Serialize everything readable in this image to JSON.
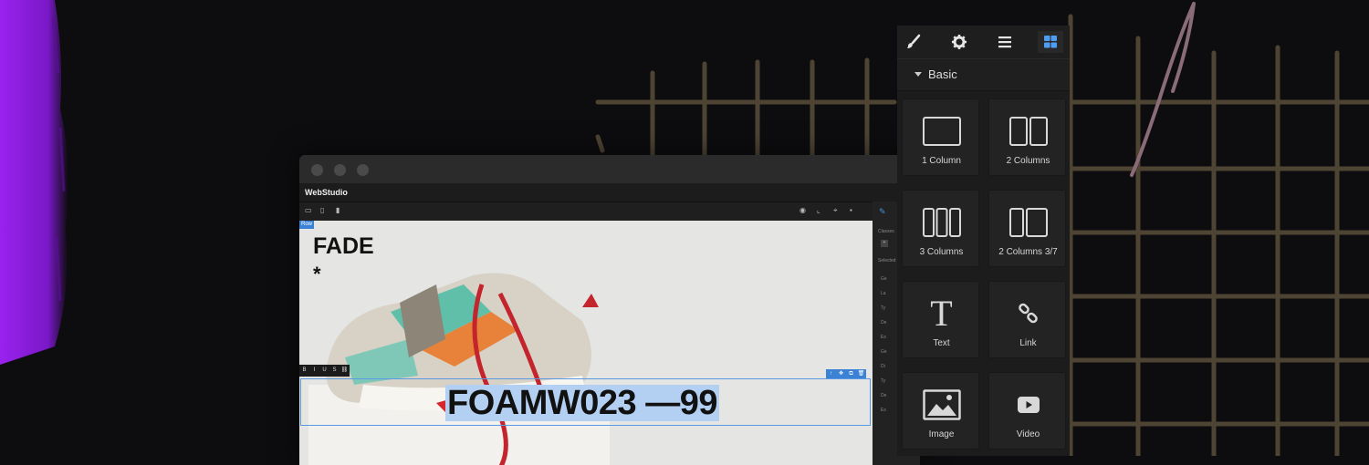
{
  "colors": {
    "background": "#0d0c0e",
    "accent_purple": "#8c1fe0",
    "grid_lines": "#4e4434",
    "selection_blue": "#3b82d6",
    "panel": "#1c1c1c"
  },
  "app": {
    "title": "WebStudio",
    "row_tag": "Row"
  },
  "canvas": {
    "brand": "FADE",
    "brand_mark": "*",
    "product_title": "FOAMW023 —99"
  },
  "rte_toolbar": [
    "B",
    "I",
    "U",
    "S",
    "⛓"
  ],
  "selection_tools": [
    "↑",
    "✥",
    "⧉",
    "🗑"
  ],
  "mini_panel": {
    "classes_label": "Classes",
    "selected_label": "Selected",
    "items": [
      "Ge",
      "La",
      "Ty",
      "De",
      "Ex",
      "Ge",
      "Di",
      "Ty",
      "De",
      "Ex"
    ]
  },
  "panel": {
    "tabs": [
      "paint-brush-icon",
      "gear-icon",
      "layers-icon",
      "blocks-icon"
    ],
    "section_title": "Basic",
    "blocks": [
      {
        "label": "1 Column",
        "icon": "one-column-icon"
      },
      {
        "label": "2 Columns",
        "icon": "two-columns-icon"
      },
      {
        "label": "3 Columns",
        "icon": "three-columns-icon"
      },
      {
        "label": "2 Columns 3/7",
        "icon": "two-columns-37-icon"
      },
      {
        "label": "Text",
        "icon": "text-icon"
      },
      {
        "label": "Link",
        "icon": "link-icon"
      },
      {
        "label": "Image",
        "icon": "image-icon"
      },
      {
        "label": "Video",
        "icon": "video-icon"
      }
    ]
  }
}
